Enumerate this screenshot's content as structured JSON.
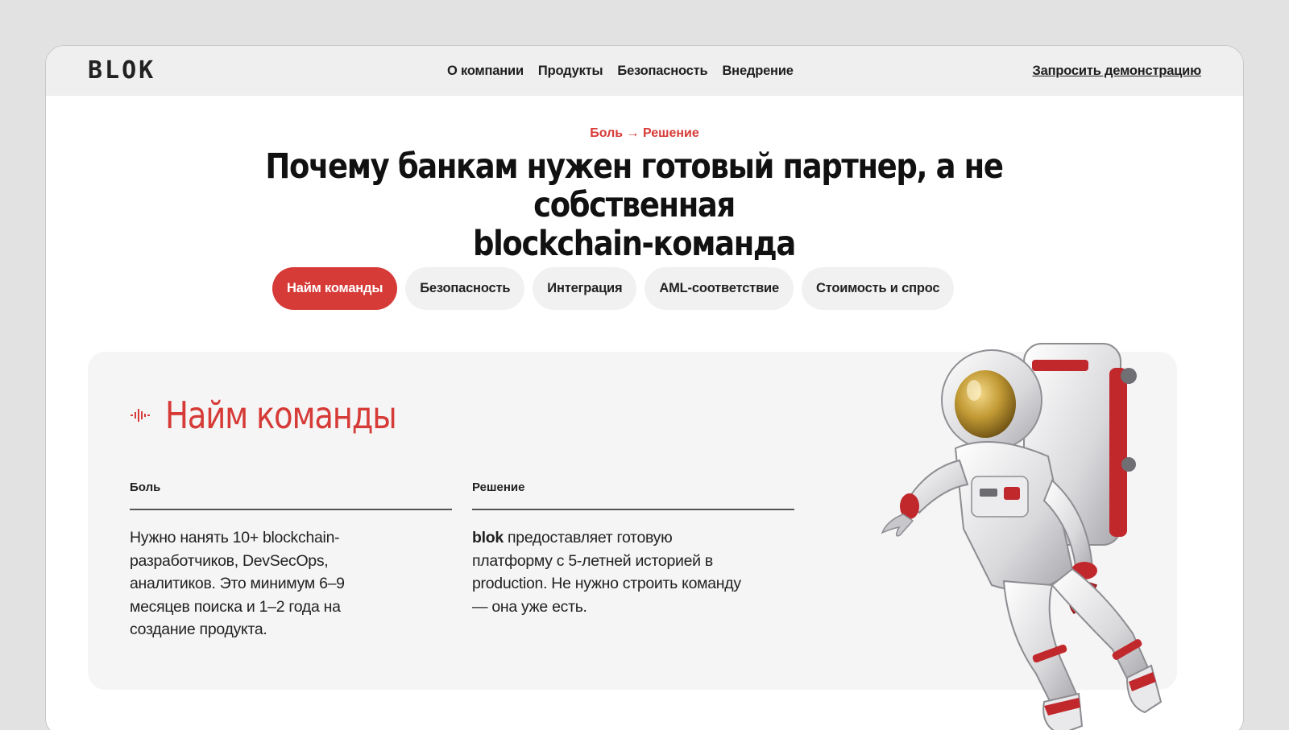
{
  "header": {
    "logo": "BLOK",
    "nav": [
      "О компании",
      "Продукты",
      "Безопасность",
      "Внедрение"
    ],
    "demo_link": "Запросить демонстрацию"
  },
  "hero": {
    "eyebrow": "Боль → Решение",
    "title_line1": "Почему банкам нужен готовый партнер, а не собственная",
    "title_line2": "blockchain-команда"
  },
  "tabs": [
    {
      "label": "Найм команды",
      "active": true
    },
    {
      "label": "Безопасность",
      "active": false
    },
    {
      "label": "Интеграция",
      "active": false
    },
    {
      "label": "AML-соответствие",
      "active": false
    },
    {
      "label": "Стоимость и спрос",
      "active": false
    }
  ],
  "card": {
    "title": "Найм команды",
    "icon": "pulse-icon",
    "pain_label": "Боль",
    "pain_text": "Нужно нанять 10+ blockchain-разработчиков, DevSecOps, аналитиков. Это минимум 6–9 месяцев поиска и 1–2 года на создание продукта.",
    "solution_label": "Решение",
    "solution_brand": "blok",
    "solution_text": " предоставляет готовую платформу с 5-летней историей в production. Не нужно строить команду — она уже есть."
  },
  "colors": {
    "accent": "#d63b37",
    "header_bg": "#efefef",
    "card_bg": "#f5f5f5"
  }
}
